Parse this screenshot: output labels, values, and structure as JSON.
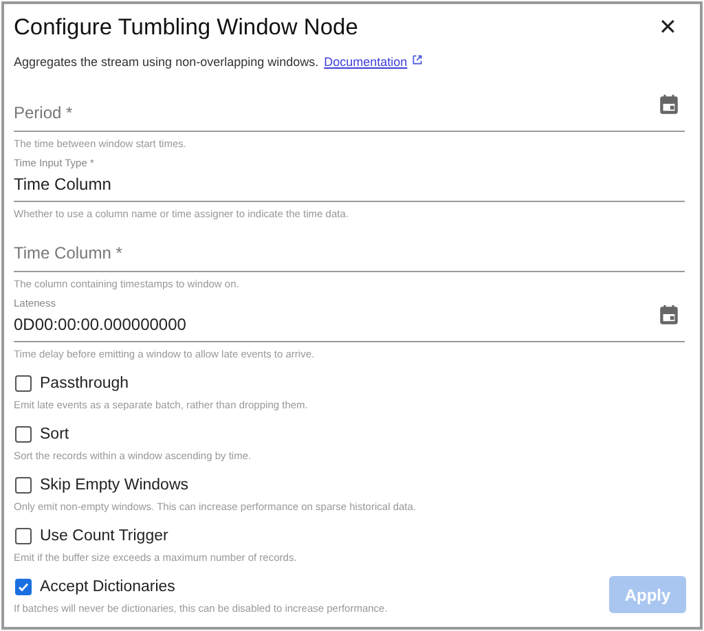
{
  "dialog": {
    "title": "Configure Tumbling Window Node",
    "description": "Aggregates the stream using non-overlapping windows.",
    "doc_link": "Documentation",
    "close": "✕"
  },
  "fields": [
    {
      "kind": "empty",
      "placeholder": "Period *",
      "hint": "The time between window start times.",
      "picker": true
    },
    {
      "kind": "filled",
      "label": "Time Input Type *",
      "value": "Time Column",
      "hint": "Whether to use a column name or time assigner to indicate the time data.",
      "picker": false
    },
    {
      "kind": "empty",
      "placeholder": "Time Column *",
      "hint": "The column containing timestamps to window on.",
      "picker": false
    },
    {
      "kind": "filled",
      "label": "Lateness",
      "value": "0D00:00:00.000000000",
      "hint": "Time delay before emitting a window to allow late events to arrive.",
      "picker": true
    }
  ],
  "options": [
    {
      "label": "Passthrough",
      "checked": false,
      "hint": "Emit late events as a separate batch, rather than dropping them."
    },
    {
      "label": "Sort",
      "checked": false,
      "hint": "Sort the records within a window ascending by time."
    },
    {
      "label": "Skip Empty Windows",
      "checked": false,
      "hint": "Only emit non-empty windows. This can increase performance on sparse historical data."
    },
    {
      "label": "Use Count Trigger",
      "checked": false,
      "hint": "Emit if the buffer size exceeds a maximum number of records."
    },
    {
      "label": "Accept Dictionaries",
      "checked": true,
      "hint": "If batches will never be dictionaries, this can be disabled to increase performance."
    }
  ],
  "apply": {
    "label": "Apply",
    "disabled": true
  }
}
